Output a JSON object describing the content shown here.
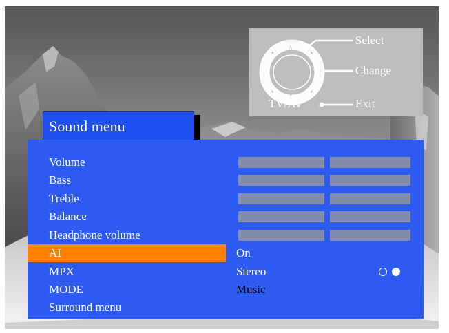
{
  "menu": {
    "title": "Sound menu",
    "items": [
      {
        "label": "Volume",
        "control": "bar"
      },
      {
        "label": "Bass",
        "control": "bar"
      },
      {
        "label": "Treble",
        "control": "bar"
      },
      {
        "label": "Balance",
        "control": "bar"
      },
      {
        "label": "Headphone volume",
        "control": "bar"
      },
      {
        "label": "AI",
        "control": "text",
        "value": "On",
        "selected": true
      },
      {
        "label": "MPX",
        "control": "text",
        "value": "Stereo",
        "indicator": [
          "off",
          "on"
        ]
      },
      {
        "label": "MODE",
        "control": "text",
        "value": "Music"
      },
      {
        "label": "Surround menu",
        "control": "submenu"
      }
    ]
  },
  "remote_legend": {
    "select_label": "Select",
    "change_label": "Change",
    "exit_label": "Exit",
    "tvav_label": "TV/AV",
    "up_symbol": "^",
    "down_symbol": "v",
    "minus_symbol": "−",
    "plus_symbol": "+"
  },
  "colors": {
    "panel": "#2e5cf2",
    "highlight": "#ff7f00",
    "bar": "#838daa",
    "legend_bg": "#bdbdbd"
  }
}
